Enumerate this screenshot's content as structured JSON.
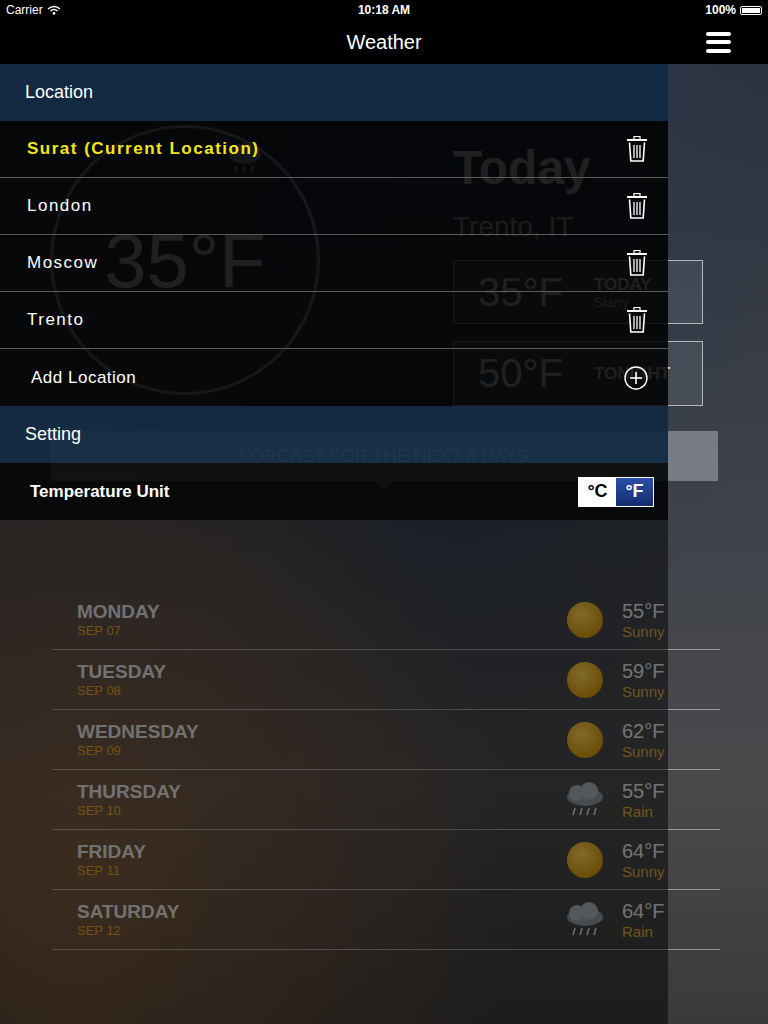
{
  "status_bar": {
    "carrier": "Carrier",
    "time": "10:18 AM",
    "battery": "100%"
  },
  "nav_bar": {
    "title": "Weather"
  },
  "current": {
    "temperature": "35°F",
    "heading": "Today",
    "location": "Trento, IT",
    "today": {
      "temperature": "35°F",
      "label": "TODAY",
      "condition": "Starry"
    },
    "tonight": {
      "temperature": "50°F",
      "label": "TONIGHT"
    }
  },
  "forecast": {
    "title": "FORCAST FOR THE NEXT 6 DAYS",
    "days": [
      {
        "day": "MONDAY",
        "date": "SEP 07",
        "temperature": "55°F",
        "condition": "Sunny",
        "kind": "sunny"
      },
      {
        "day": "TUESDAY",
        "date": "SEP 08",
        "temperature": "59°F",
        "condition": "Sunny",
        "kind": "sunny"
      },
      {
        "day": "WEDNESDAY",
        "date": "SEP 09",
        "temperature": "62°F",
        "condition": "Sunny",
        "kind": "sunny"
      },
      {
        "day": "THURSDAY",
        "date": "SEP 10",
        "temperature": "55°F",
        "condition": "Rain",
        "kind": "rain"
      },
      {
        "day": "FRIDAY",
        "date": "SEP 11",
        "temperature": "64°F",
        "condition": "Sunny",
        "kind": "sunny"
      },
      {
        "day": "SATURDAY",
        "date": "SEP 12",
        "temperature": "64°F",
        "condition": "Rain",
        "kind": "rain"
      }
    ]
  },
  "menu": {
    "location_header": "Location",
    "locations": [
      {
        "name": "Surat (Current Location)",
        "selected": true
      },
      {
        "name": "London",
        "selected": false
      },
      {
        "name": "Moscow",
        "selected": false
      },
      {
        "name": "Trento",
        "selected": false
      }
    ],
    "add_label": "Add Location",
    "settings_header": "Setting",
    "temperature_unit": {
      "label": "Temperature Unit",
      "options": [
        {
          "label": "°C",
          "selected": false
        },
        {
          "label": "°F",
          "selected": true
        }
      ]
    }
  }
}
